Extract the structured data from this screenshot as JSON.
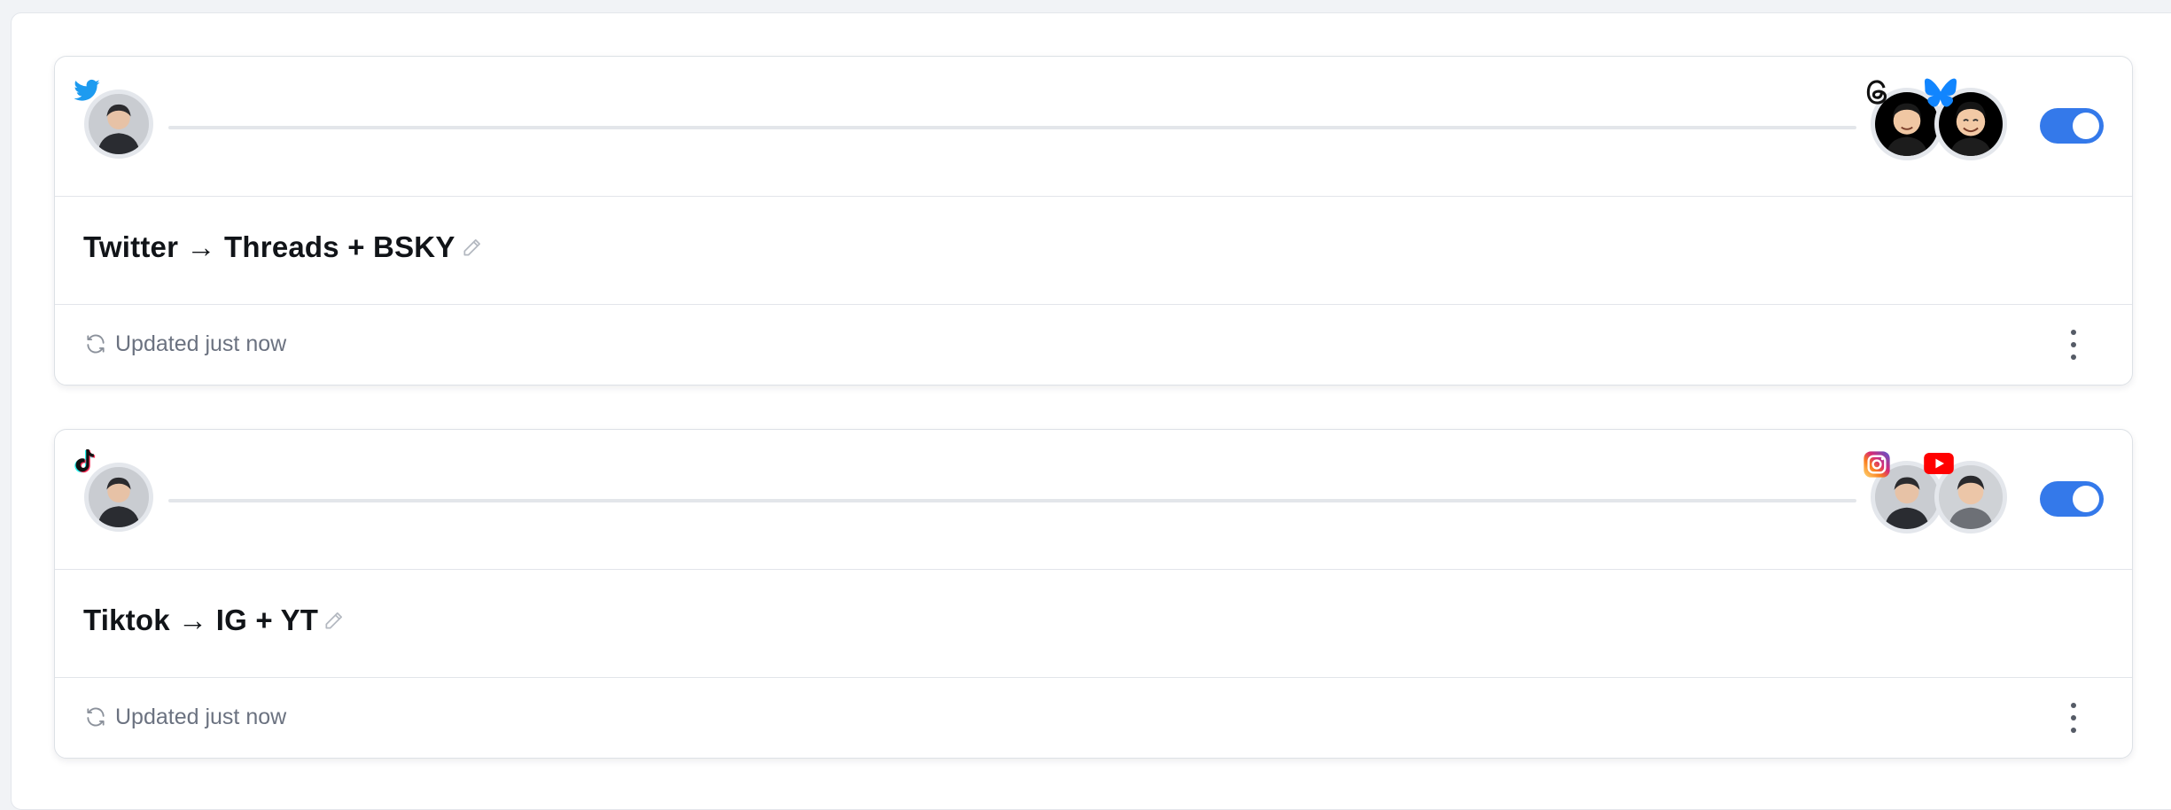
{
  "flows": [
    {
      "title": "Twitter → Threads + BSKY",
      "source_platform": "twitter-icon",
      "destination_platforms": [
        "threads-icon",
        "bluesky-icon"
      ],
      "enabled": true,
      "status": "Updated just now"
    },
    {
      "title": "Tiktok → IG + YT",
      "source_platform": "tiktok-icon",
      "destination_platforms": [
        "instagram-icon",
        "youtube-icon"
      ],
      "enabled": true,
      "status": "Updated just now"
    }
  ],
  "colors": {
    "accent": "#3479ea",
    "twitter": "#1d9bf0",
    "bluesky": "#1185fe",
    "youtube": "#ff0000",
    "muted_text": "#6b7280"
  }
}
